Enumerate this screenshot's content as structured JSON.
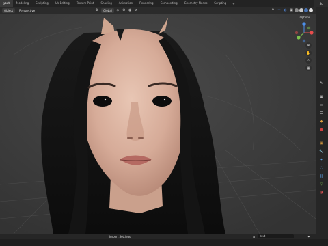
{
  "workspaces": {
    "active": "Layout",
    "active_visible": "yout",
    "tabs": [
      "Modeling",
      "Sculpting",
      "UV Editing",
      "Texture Paint",
      "Shading",
      "Animation",
      "Rendering",
      "Compositing",
      "Geometry Nodes",
      "Scripting"
    ],
    "add": "+"
  },
  "top_right_label": "Sc",
  "header": {
    "mode": "Object",
    "transform_orientation": "Global",
    "menu_perspective": "Perspective"
  },
  "viewport": {
    "options_label": "Options",
    "gizmo_axes": [
      "X",
      "Y",
      "Z"
    ]
  },
  "status": {
    "center": "Import Settings",
    "search_value": "text"
  },
  "colors": {
    "axis_x": "#e84d4d",
    "axis_y": "#7ec24d",
    "axis_z": "#4d8fe8",
    "accent": "#4772b3"
  }
}
